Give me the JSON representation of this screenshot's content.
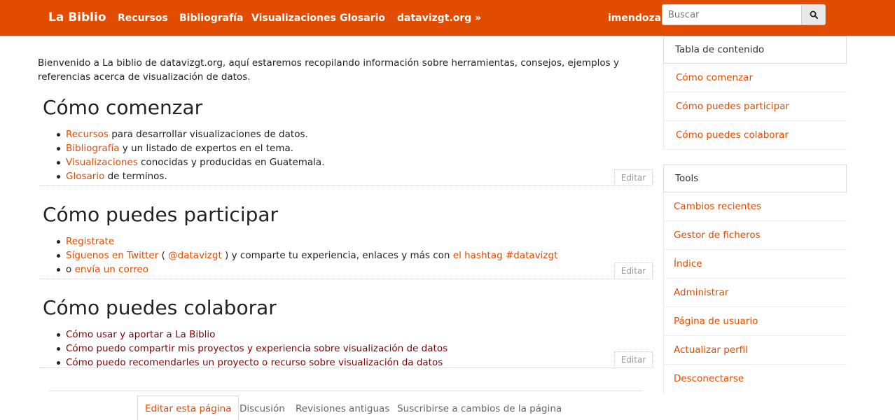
{
  "navbar": {
    "brand": "La Biblio",
    "links": [
      "Recursos",
      "Bibliografía",
      "Visualizaciones",
      "Glosario",
      "datavizgt.org »"
    ],
    "username": "imendoza",
    "search_placeholder": "Buscar",
    "search_icon": "search-icon"
  },
  "intro": "Bienvenido a La biblio de datavizgt.org, aquí estaremos recopilando información sobre herramientas, consejos, ejemplos y referencias acerca de visualización de datos.",
  "sections": [
    {
      "title": "Cómo comenzar",
      "items": [
        {
          "link": "Recursos",
          "text": " para desarrollar visualizaciones de datos."
        },
        {
          "link": "Bibliografía",
          "text": " y un listado de expertos en el tema."
        },
        {
          "link": "Visualizaciones",
          "text": " conocidas y producidas en Guatemala."
        },
        {
          "link": "Glosario",
          "text": " de terminos."
        }
      ],
      "edit_label": "Editar"
    },
    {
      "title": "Cómo puedes participar",
      "items": [
        {
          "link": "Registrate"
        },
        {
          "link": "Síguenos en Twitter",
          "paren_open": " ( ",
          "handle": "@datavizgt",
          "paren_close": " ) y comparte tu experiencia, enlaces y más con ",
          "hashtag": "el hashtag #datavizgt"
        },
        {
          "prefix": "o ",
          "link": "envía un correo"
        }
      ],
      "edit_label": "Editar"
    },
    {
      "title": "Cómo puedes colaborar",
      "items": [
        {
          "link": "Cómo usar y aportar a La Biblio"
        },
        {
          "link": "Cómo puedo compartir mis proyectos y experiencia sobre visualización de datos"
        },
        {
          "link": "Cómo puedo recomendarles un proyecto o recurso sobre visualización da datos"
        }
      ],
      "edit_label": "Editar"
    }
  ],
  "page_tabs": [
    "Editar esta página",
    "Discusión",
    "Revisiones antiguas",
    "Suscribirse a cambios de la página"
  ],
  "sidebar": {
    "toc_title": "Tabla de contenido",
    "toc_items": [
      "Cómo comenzar",
      "Cómo puedes participar",
      "Cómo puedes colaborar"
    ],
    "tools_title": "Tools",
    "tools_items": [
      "Cambios recientes",
      "Gestor de ficheros",
      "Índice",
      "Administrar",
      "Página de usuario",
      "Actualizar perfil",
      "Desconectarse"
    ]
  },
  "colors": {
    "brand": "#e24c00",
    "internal_link": "#8a0000"
  }
}
